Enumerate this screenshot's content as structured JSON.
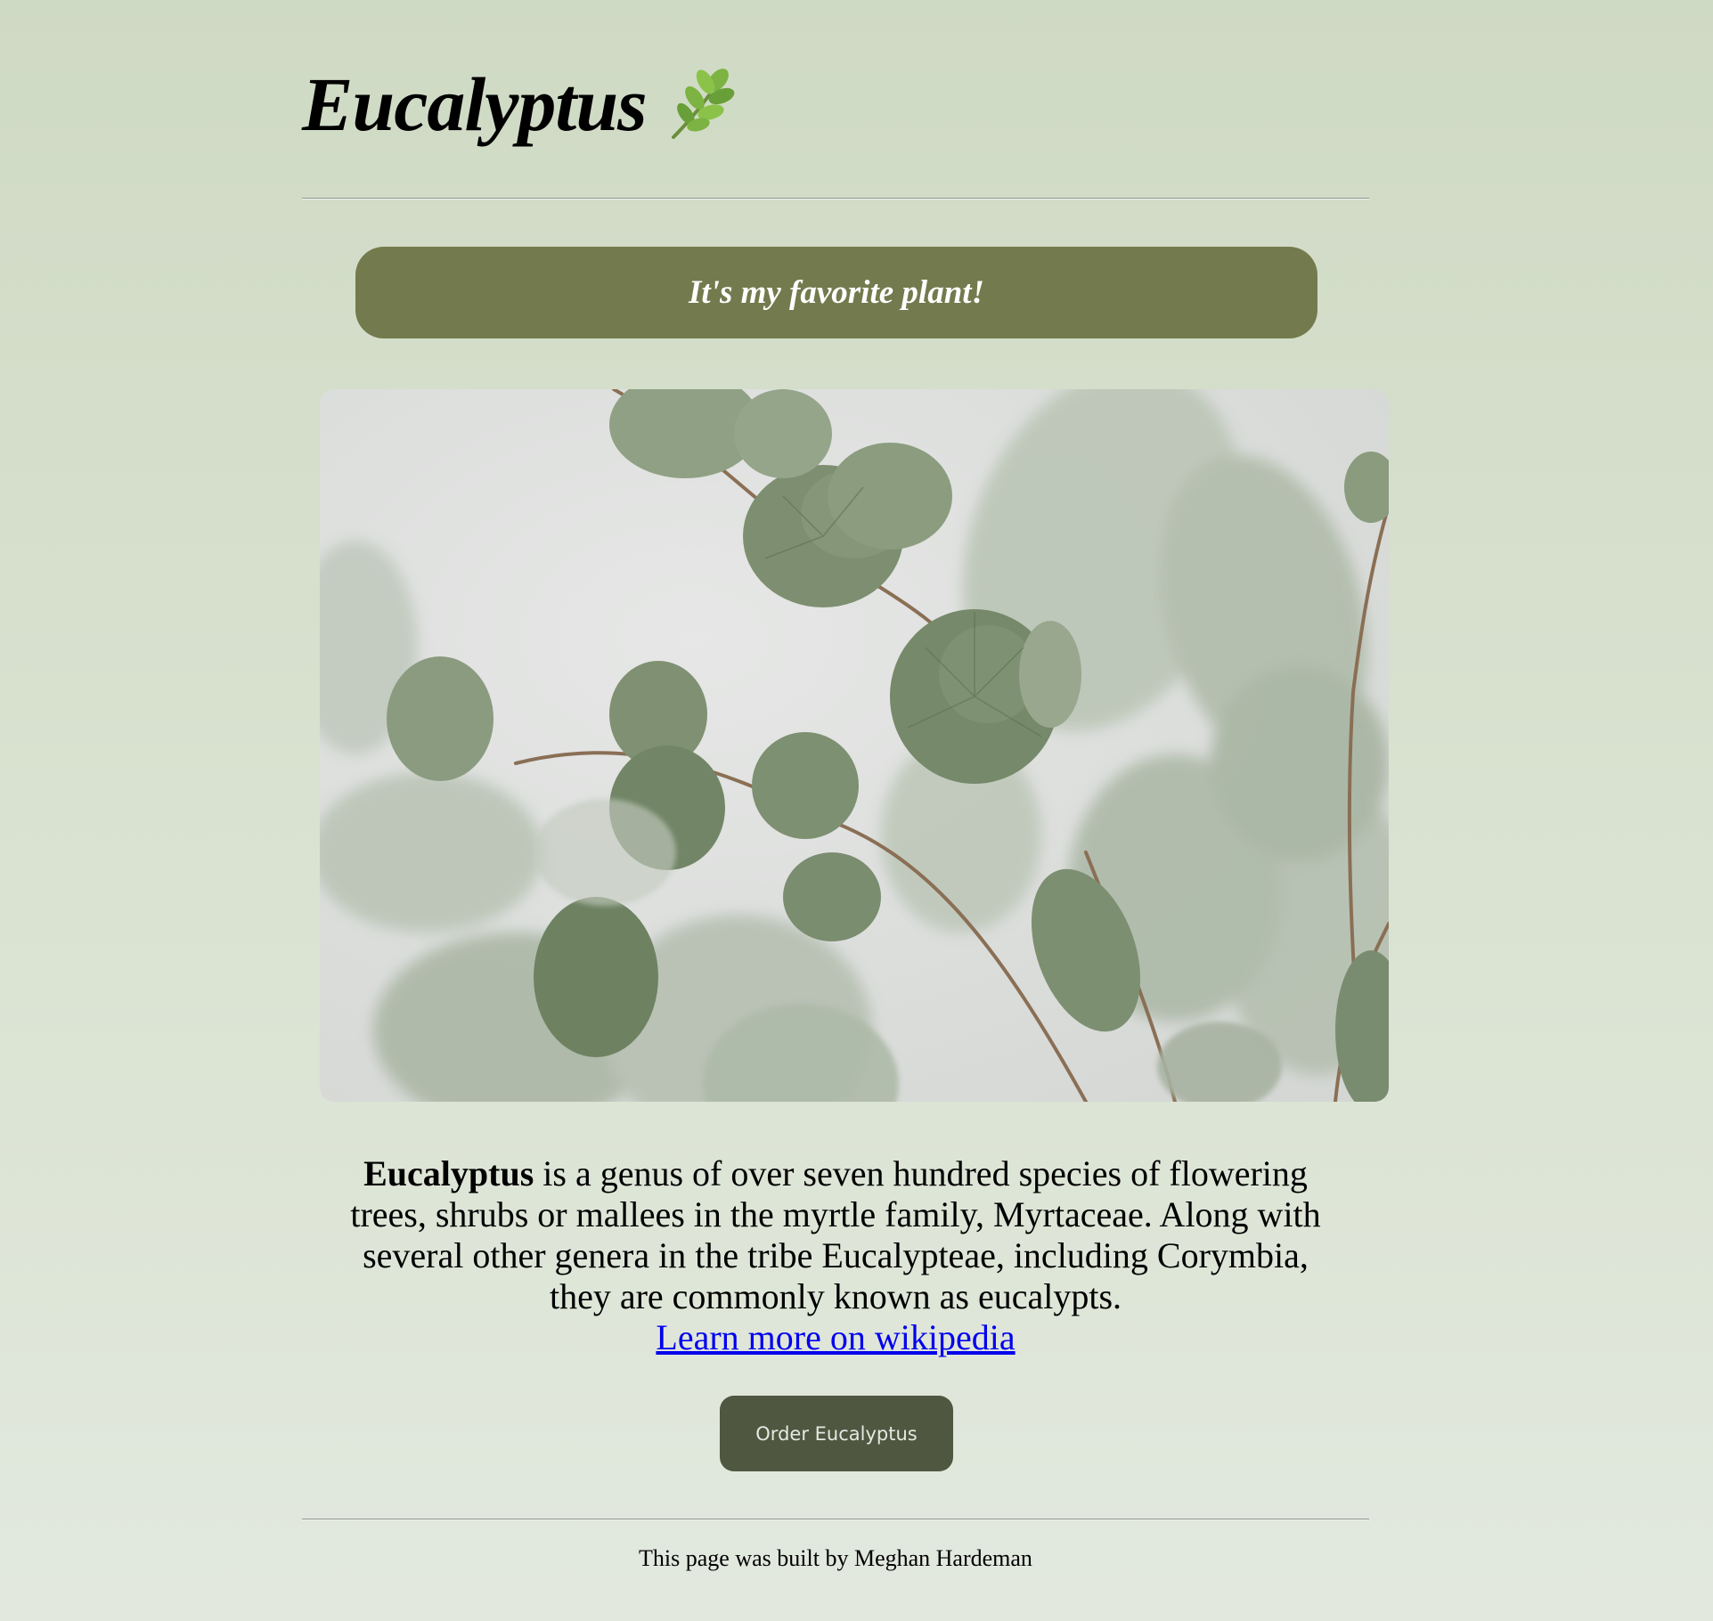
{
  "header": {
    "title": "Eucalyptus",
    "title_icon": "leaf-icon"
  },
  "banner": {
    "text": "It's my favorite plant!"
  },
  "image": {
    "subject": "eucalyptus branches with round sage-green leaves",
    "icon": "photo"
  },
  "description": {
    "bold_term": "Eucalyptus",
    "text": " is a genus of over seven hundred species of flowering trees, shrubs or mallees in the myrtle family, Myrtaceae. Along with several other genera in the tribe Eucalypteae, including Corymbia, they are commonly known as eucalypts.",
    "link_text": "Learn more on wikipedia"
  },
  "actions": {
    "order_label": "Order Eucalyptus"
  },
  "footer": {
    "text": "This page was built by Meghan Hardeman"
  },
  "colors": {
    "background_top": "#cfdac4",
    "background_bottom": "#e2e8de",
    "banner": "#737a4d",
    "button": "#4f5740",
    "link": "#0000ee"
  }
}
